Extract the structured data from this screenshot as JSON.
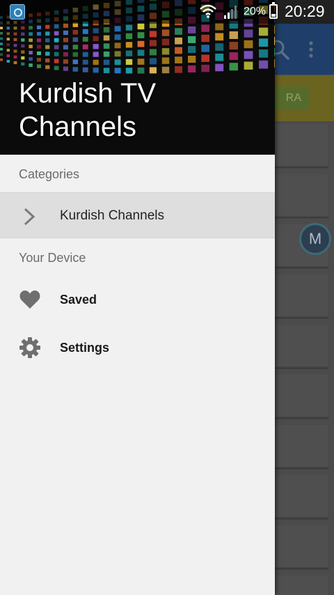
{
  "status_bar": {
    "battery": "20%",
    "time": "20:29"
  },
  "background_app": {
    "banner_text": "RA",
    "fab_letter": "M"
  },
  "drawer": {
    "title": "Kurdish TV Channels",
    "sections": [
      {
        "header": "Categories",
        "items": [
          {
            "label": "Kurdish Channels",
            "icon": "chevron-right-icon",
            "selected": true
          }
        ]
      },
      {
        "header": "Your Device",
        "items": [
          {
            "label": "Saved",
            "icon": "heart-icon"
          },
          {
            "label": "Settings",
            "icon": "gear-icon"
          }
        ]
      }
    ]
  },
  "colors": {
    "drawer_background": "#f1f1f1",
    "selected_item": "#dedede",
    "toolbar": "#1f3f6a",
    "section_header_text": "#6b6b6b",
    "icon_gray": "#6f6f6f"
  }
}
